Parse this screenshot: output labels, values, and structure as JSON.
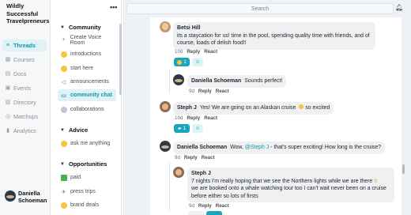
{
  "community": {
    "name": "Wildly Successful Travelpreneurs"
  },
  "rail": {
    "items": [
      {
        "label": "Threads",
        "icon": "threads-icon",
        "active": true
      },
      {
        "label": "Courses",
        "icon": "courses-icon",
        "active": false
      },
      {
        "label": "Docs",
        "icon": "docs-icon",
        "active": false
      },
      {
        "label": "Events",
        "icon": "events-icon",
        "active": false
      },
      {
        "label": "Directory",
        "icon": "directory-icon",
        "active": false
      },
      {
        "label": "Matchups",
        "icon": "matchups-icon",
        "active": false
      },
      {
        "label": "Analytics",
        "icon": "analytics-icon",
        "active": false
      }
    ],
    "user": "Daniella Schoeman"
  },
  "sidebar": {
    "more": "•••",
    "sections": [
      {
        "title": "Community",
        "items": [
          {
            "label": "Create Voice Room",
            "icon": "plus-icon"
          },
          {
            "label": "introductions",
            "icon": "emoji-icon"
          },
          {
            "label": "start here",
            "icon": "emoji-icon"
          },
          {
            "label": "announcements",
            "icon": "megaphone-icon"
          },
          {
            "label": "community chat",
            "icon": "chat-icon",
            "active": true
          },
          {
            "label": "collaborations",
            "icon": "emoji-icon"
          }
        ]
      },
      {
        "title": "Advice",
        "items": [
          {
            "label": "ask me anything",
            "icon": "emoji-icon"
          }
        ]
      },
      {
        "title": "Opportunities",
        "items": [
          {
            "label": "paid",
            "icon": "money-icon"
          },
          {
            "label": "press trips",
            "icon": "plane-icon"
          },
          {
            "label": "brand deals",
            "icon": "emoji-icon"
          }
        ]
      }
    ]
  },
  "search": {
    "placeholder": "Search"
  },
  "feed": {
    "messages": [
      {
        "author": "Betsi Hill",
        "text": "its a staycation for us! time in the pool, spending quality time with friends, and of course, loads of delish food!!",
        "time": "10d",
        "reply": "Reply",
        "react": "React",
        "reaction_count": "1"
      },
      {
        "author": "Daniella Schoeman",
        "text": "Sounds perfect!",
        "time": "9d",
        "reply": "Reply",
        "react": "React"
      },
      {
        "author": "Steph J",
        "text": "Yes! We are going on an Alaskan cruise",
        "text_after": "so excited",
        "time": "10d",
        "reply": "Reply",
        "react": "React",
        "reaction_count": "1"
      },
      {
        "author": "Daniella Schoeman",
        "text_before": "Wow,",
        "mention": "@Steph J",
        "text": "- that's super exciting! How long is the cruise?",
        "time": "9d",
        "reply": "Reply",
        "react": "React"
      },
      {
        "author": "Steph J",
        "text": "7 nights I'm really hoping that we see the Northern lights while we are there",
        "text2": "we are booked onto a whale watching tour too I can't wait never been on a cruise before either so lots of firsts",
        "time": "9d",
        "reply": "Reply",
        "react": "React"
      }
    ]
  }
}
